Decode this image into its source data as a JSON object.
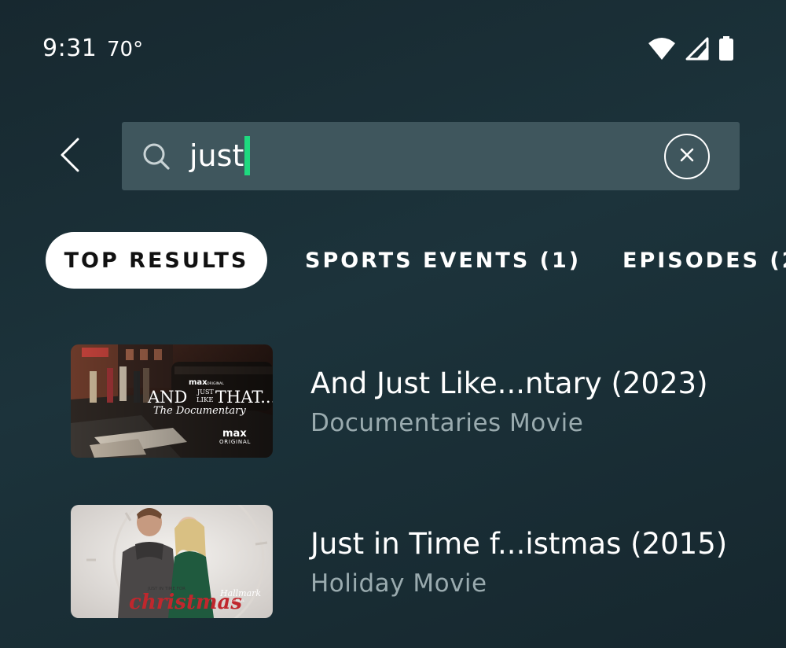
{
  "status_bar": {
    "time": "9:31",
    "temperature": "70°",
    "icons": [
      "wifi-icon",
      "cell-signal-icon",
      "battery-icon"
    ]
  },
  "search": {
    "query": "just",
    "caret_color": "#1ed97f"
  },
  "tabs": [
    {
      "label": "TOP RESULTS",
      "active": true
    },
    {
      "label": "SPORTS EVENTS (1)",
      "active": false
    },
    {
      "label": "EPISODES (2",
      "active": false
    }
  ],
  "results": [
    {
      "title": "And Just Like...ntary (2023)",
      "subtitle": "Documentaries Movie",
      "thumbnail": {
        "brand": "max",
        "badge": "ORIGINAL",
        "small_brand": "max",
        "small_badge": "ORIGINAL",
        "title_words": [
          "AND",
          "JUST",
          "LIKE",
          "THAT..."
        ],
        "script_text": "The Documentary"
      }
    },
    {
      "title": "Just in Time f...istmas (2015)",
      "subtitle": "Holiday Movie",
      "thumbnail": {
        "small_text": "JUST IN TIME FOR",
        "script_text": "christmas",
        "network": "Hallmark",
        "network_sub": "CHANNEL"
      }
    }
  ]
}
